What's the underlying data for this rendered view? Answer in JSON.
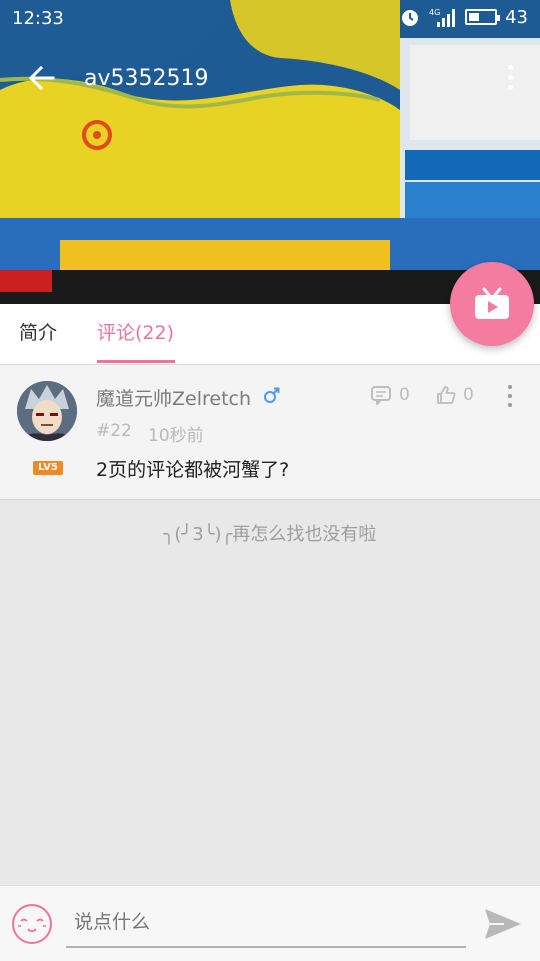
{
  "status_bar": {
    "time": "12:33",
    "network": "4G",
    "battery": "43",
    "battery_level": 0.43
  },
  "video": {
    "title": "av5352519"
  },
  "tabs": [
    {
      "label": "简介",
      "active": false
    },
    {
      "label": "评论(22)",
      "active": true
    }
  ],
  "comment": {
    "username": "魔道元帅Zelretch",
    "gender_icon": "male-icon",
    "level": "LV5",
    "floor": "#22",
    "time": "10秒前",
    "reply_count": "0",
    "like_count": "0",
    "text": "2页的评论都被河蟹了?"
  },
  "empty_message": "╮(╯3╰)╭再怎么找也没有啦",
  "input": {
    "placeholder": "说点什么"
  },
  "colors": {
    "accent": "#f0739a",
    "fab": "#f47ca0",
    "level_badge": "#f08a24"
  }
}
